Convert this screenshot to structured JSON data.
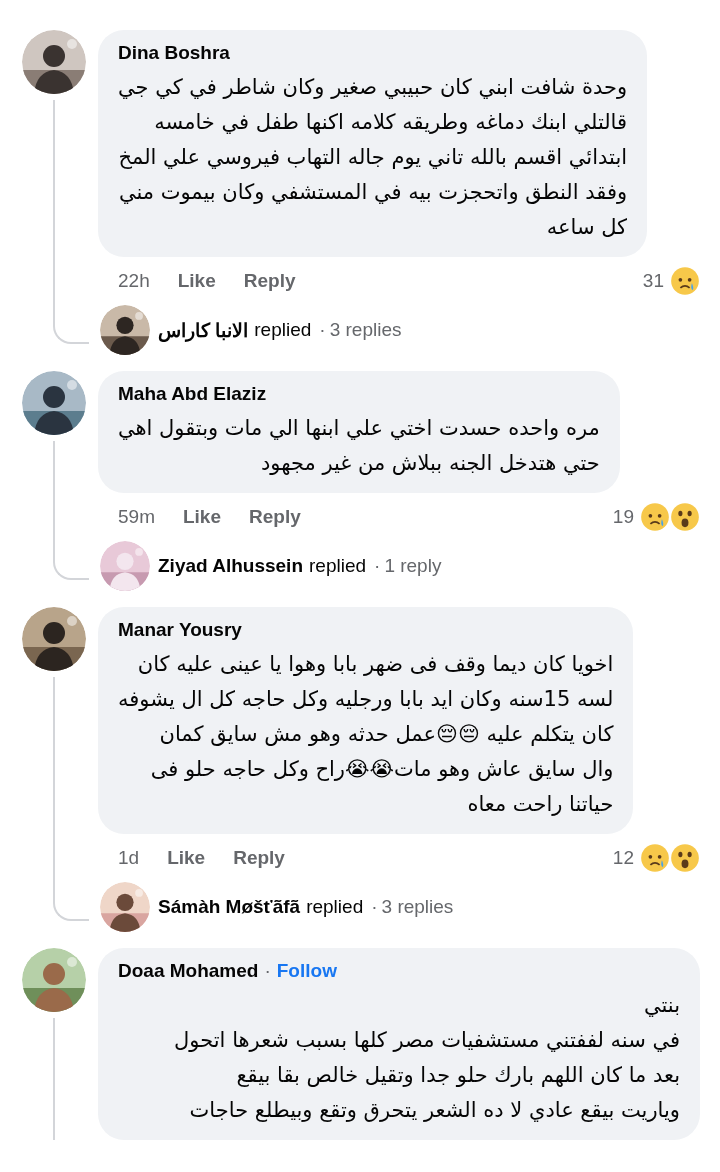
{
  "comments": [
    {
      "author": "Dina Boshra",
      "lines": [
        "وحدة شافت ابني كان حبيبي صغير وكان شاطر في كي جي",
        "قالتلي ابنك دماغه  وطريقه كلامه اكنها طفل في خامسه",
        "ابتدائي اقسم بالله تاني يوم جاله التهاب فيروسي علي المخ",
        "وفقد النطق واتحجزت بيه في المستشفي وكان بيموت مني",
        "كل ساعه"
      ],
      "time": "22h",
      "like": "Like",
      "reply": "Reply",
      "reaction_count": "31",
      "reactions": [
        {
          "kind": "sad"
        }
      ],
      "replies": {
        "name": "الانبا كاراس",
        "verb": "replied",
        "separator": "·",
        "count": "3 replies"
      }
    },
    {
      "author": "Maha Abd Elaziz",
      "lines": [
        "مره واحده حسدت اختي علي ابنها الي مات وبتقول اهي",
        "حتي هتدخل الجنه ببلاش من غير مجهود"
      ],
      "time": "59m",
      "like": "Like",
      "reply": "Reply",
      "reaction_count": "19",
      "reactions": [
        {
          "kind": "sad"
        },
        {
          "kind": "wow"
        }
      ],
      "replies": {
        "name": "Ziyad Alhussein",
        "verb": "replied",
        "separator": "·",
        "count": "1 reply"
      }
    },
    {
      "author": "Manar Yousry",
      "lines": [
        "اخويا كان ديما وقف فى ضهر بابا وهوا يا عينى عليه كان",
        "لسه 15سنه وكان ايد بابا ورجليه وكل حاجه كل ال يشوفه",
        "كان يتكلم عليه 😔😔عمل حدثه وهو مش سايق كمان",
        "وال سايق عاش وهو مات😭😭راح وكل حاجه حلو فى",
        "حياتنا راحت معاه"
      ],
      "time": "1d",
      "like": "Like",
      "reply": "Reply",
      "reaction_count": "12",
      "reactions": [
        {
          "kind": "sad"
        },
        {
          "kind": "wow"
        }
      ],
      "replies": {
        "name": "Sámàh Møšťãfã",
        "verb": "replied",
        "separator": "·",
        "count": "3 replies"
      }
    },
    {
      "author": "Doaa Mohamed",
      "separator": "·",
      "follow": "Follow",
      "lines": [
        "بنتي",
        "في سنه لففتني مستشفيات مصر كلها بسبب شعرها اتحول",
        "بعد ما كان اللهم بارك حلو جدا وتقيل خالص بقا بيقع",
        "وياريت بيقع عادي لا ده الشعر يتحرق وتقع وبيطلع حاجات"
      ]
    }
  ]
}
